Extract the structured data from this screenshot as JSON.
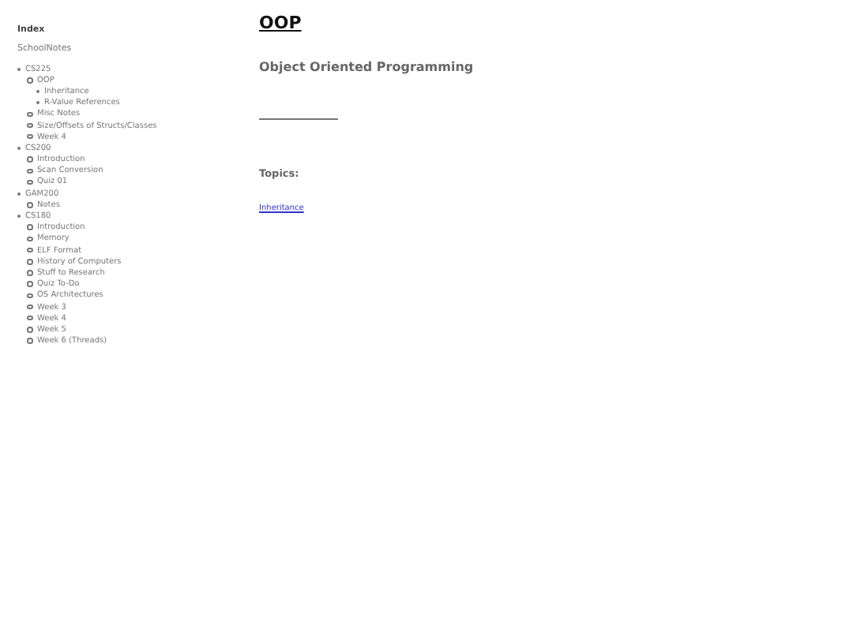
{
  "sidebar": {
    "title": "Index",
    "subtitle": "SchoolNotes",
    "tree": [
      {
        "label": "CS225",
        "children": [
          {
            "label": "OOP",
            "children": [
              {
                "label": "Inheritance"
              },
              {
                "label": "R-Value References"
              }
            ]
          },
          {
            "label": "Misc Notes"
          },
          {
            "label": "Size/Offsets of Structs/Classes"
          },
          {
            "label": "Week 4"
          }
        ]
      },
      {
        "label": "CS200",
        "children": [
          {
            "label": "Introduction"
          },
          {
            "label": "Scan Conversion"
          },
          {
            "label": "Quiz 01"
          }
        ]
      },
      {
        "label": "GAM200",
        "children": [
          {
            "label": "Notes"
          }
        ]
      },
      {
        "label": "CS180",
        "children": [
          {
            "label": "Introduction"
          },
          {
            "label": "Memory"
          },
          {
            "label": "ELF Format"
          },
          {
            "label": "History of Computers"
          },
          {
            "label": "Stuff to Research"
          },
          {
            "label": "Quiz To-Do"
          },
          {
            "label": "OS Architectures"
          },
          {
            "label": "Week 3"
          },
          {
            "label": "Week 4"
          },
          {
            "label": "Week 5"
          },
          {
            "label": "Week 6 (Threads)"
          }
        ]
      }
    ]
  },
  "page": {
    "title": "OOP",
    "subtitle": "Object Oriented Programming",
    "topics_heading": "Topics:",
    "links": [
      "Inheritance"
    ]
  }
}
